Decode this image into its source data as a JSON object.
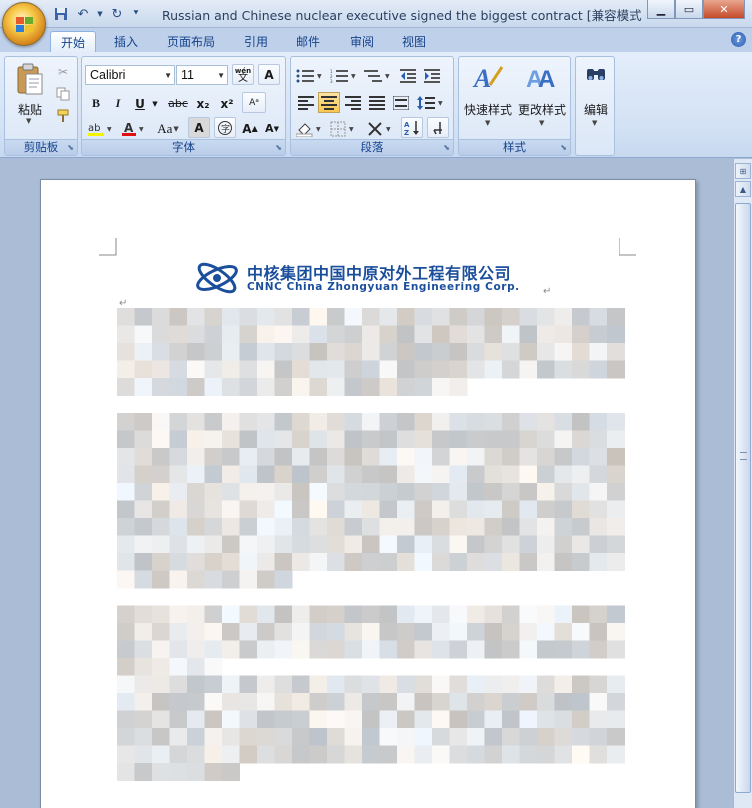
{
  "window": {
    "title": "Russian and Chinese nuclear executive signed the biggest contract [兼容模式] - M..."
  },
  "tabs": [
    {
      "label": "开始",
      "active": true
    },
    {
      "label": "插入"
    },
    {
      "label": "页面布局"
    },
    {
      "label": "引用"
    },
    {
      "label": "邮件"
    },
    {
      "label": "审阅"
    },
    {
      "label": "视图"
    }
  ],
  "ribbon": {
    "clipboard": {
      "label": "剪贴板",
      "paste": "粘贴"
    },
    "font": {
      "label": "字体",
      "name": "Calibri",
      "size": "11",
      "bold": "B",
      "italic": "I",
      "underline": "U",
      "strike": "abc",
      "subscript": "x₂",
      "superscript": "x²",
      "case": "Aa",
      "grow": "A",
      "shrink": "A",
      "phonetic": "wén"
    },
    "paragraph": {
      "label": "段落"
    },
    "styles": {
      "label": "样式",
      "quick": "快速样式",
      "change": "更改样式"
    },
    "editing": {
      "label": "编辑"
    }
  },
  "document": {
    "logo_cn": "中核集团中国中原对外工程有限公司",
    "logo_en": "CNNC China Zhongyuan Engineering Corp.",
    "body_obscured": true
  },
  "colors": {
    "ribbon_text": "#15428b",
    "logo_blue": "#1b4f9c"
  }
}
